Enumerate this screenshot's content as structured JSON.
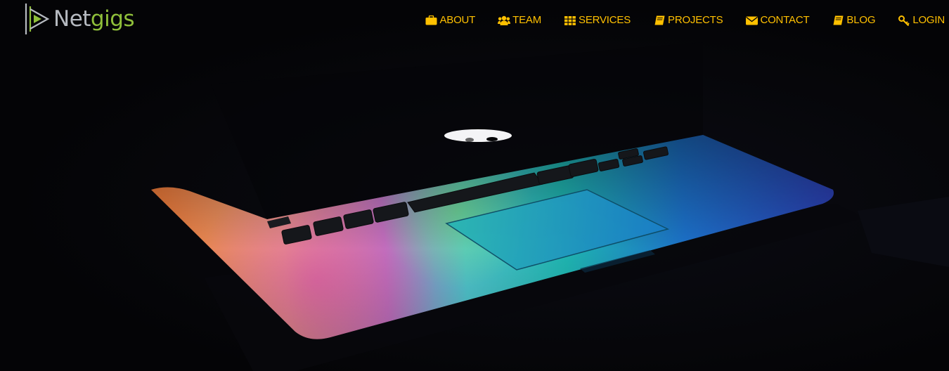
{
  "brand": {
    "name_part1": "Net",
    "name_part2": "gigs",
    "logo_icon": "play-triangle-logo",
    "color_net": "#b6bac0",
    "color_gigs": "#8fbf3a"
  },
  "nav": {
    "accent_color": "#ffc000",
    "items": [
      {
        "label": "ABOUT",
        "icon": "briefcase-icon"
      },
      {
        "label": "TEAM",
        "icon": "users-icon"
      },
      {
        "label": "SERVICES",
        "icon": "grid-icon"
      },
      {
        "label": "PROJECTS",
        "icon": "book-icon"
      },
      {
        "label": "CONTACT",
        "icon": "envelope-icon"
      },
      {
        "label": "BLOG",
        "icon": "book-icon"
      },
      {
        "label": "LOGIN",
        "icon": "key-icon"
      }
    ]
  },
  "hero": {
    "image_subject": "laptop-glowing-rainbow-keyboard"
  }
}
